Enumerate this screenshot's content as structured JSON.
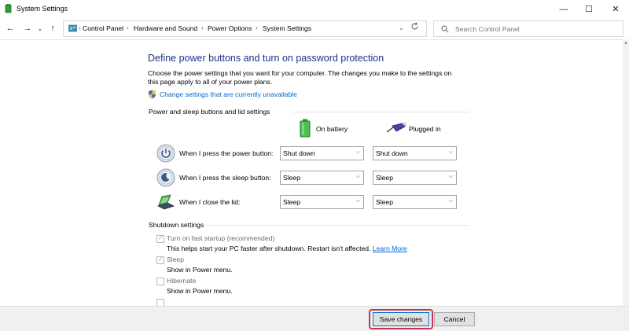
{
  "window": {
    "title": "System Settings",
    "controls": {
      "minimize": "—",
      "maximize": "☐",
      "close": "✕"
    }
  },
  "nav": {
    "back": "←",
    "forward": "→",
    "dropdown": "⌄",
    "up": "↑",
    "breadcrumb": [
      "Control Panel",
      "Hardware and Sound",
      "Power Options",
      "System Settings"
    ],
    "breadcrumb_sep": "›",
    "search_placeholder": "Search Control Panel"
  },
  "main": {
    "heading": "Define power buttons and turn on password protection",
    "description": "Choose the power settings that you want for your computer. The changes you make to the settings on this page apply to all of your power plans.",
    "change_link": "Change settings that are currently unavailable",
    "power_group_title": "Power and sleep buttons and lid settings",
    "columns": {
      "battery": "On battery",
      "plugged": "Plugged in"
    },
    "rows": [
      {
        "label": "When I press the power button:",
        "battery": "Shut down",
        "plugged": "Shut down",
        "icon": "power-icon"
      },
      {
        "label": "When I press the sleep button:",
        "battery": "Sleep",
        "plugged": "Sleep",
        "icon": "sleep-icon"
      },
      {
        "label": "When I close the lid:",
        "battery": "Sleep",
        "plugged": "Sleep",
        "icon": "laptop-lid-icon"
      }
    ],
    "shutdown_group_title": "Shutdown settings",
    "shutdown": [
      {
        "label": "Turn on fast startup (recommended)",
        "desc": "This helps start your PC faster after shutdown. Restart isn't affected.",
        "link": "Learn More",
        "checked": true
      },
      {
        "label": "Sleep",
        "desc": "Show in Power menu.",
        "checked": true
      },
      {
        "label": "Hibernate",
        "desc": "Show in Power menu.",
        "checked": false
      }
    ]
  },
  "footer": {
    "save": "Save changes",
    "cancel": "Cancel"
  },
  "colors": {
    "heading": "#1e3287",
    "link": "#0066cc",
    "highlight": "#c83349"
  }
}
